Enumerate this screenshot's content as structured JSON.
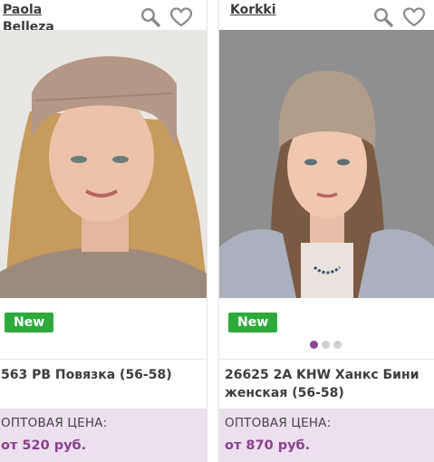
{
  "products": [
    {
      "brand": "Paola\nBelleza",
      "badge": "New",
      "title": "563 PB Повязка (56-58)",
      "price_label": "ОПТОВАЯ ЦЕНА:",
      "price": "от 520 руб.",
      "photo": "woman-wearing-knit-headband"
    },
    {
      "brand": "Korkki",
      "badge": "New",
      "title": "26625 2A KHW Ханкс Бини\nженская (56-58)",
      "price_label": "ОПТОВАЯ ЦЕНА:",
      "price": "от 870 руб.",
      "photo": "woman-wearing-knit-beanie",
      "carousel": {
        "count": 3,
        "active": 1
      }
    }
  ],
  "icons": [
    "search-icon",
    "heart-icon"
  ],
  "colors": {
    "badge": "#2eaa3d",
    "price_accent": "#8b3f8f",
    "price_bg": "#ece0ee",
    "active_dot": "#8e4796"
  }
}
